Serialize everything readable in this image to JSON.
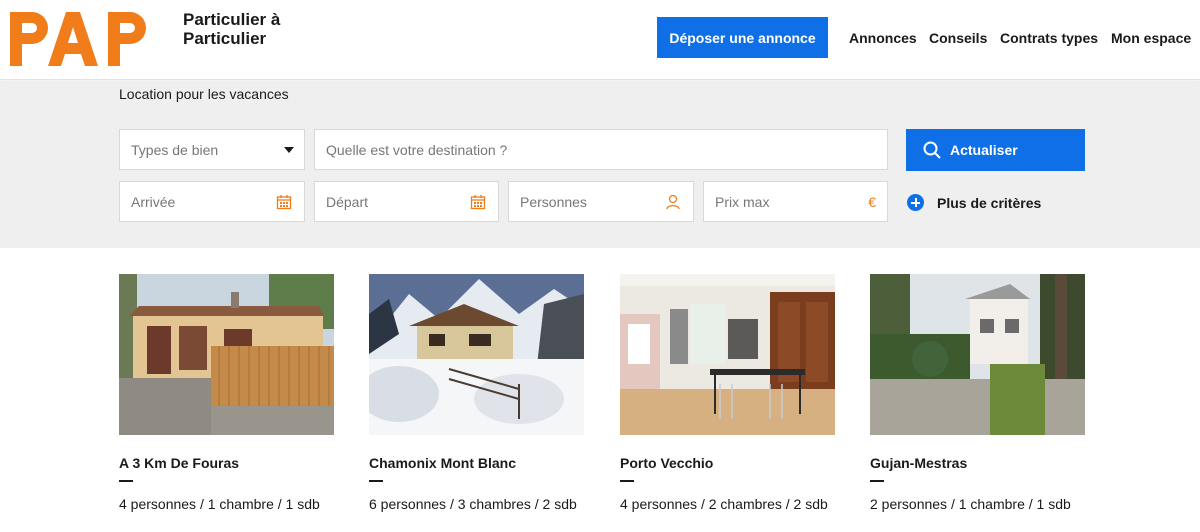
{
  "header": {
    "logo_text": "PAP",
    "tagline_line1": "Particulier à",
    "tagline_line2": "Particulier",
    "cta_label": "Déposer une annonce",
    "nav": [
      "Annonces",
      "Conseils",
      "Contrats types",
      "Mon espace"
    ],
    "brand_color": "#f07d1a",
    "accent_color": "#0f6fe6"
  },
  "search": {
    "title": "Location pour les vacances",
    "types_placeholder": "Types de bien",
    "destination_placeholder": "Quelle est votre destination ?",
    "arrival_placeholder": "Arrivée",
    "departure_placeholder": "Départ",
    "persons_placeholder": "Personnes",
    "price_placeholder": "Prix max",
    "currency_symbol": "€",
    "update_label": "Actualiser",
    "more_criteria_label": "Plus de critères"
  },
  "listings": [
    {
      "title": "A 3 Km De Fouras",
      "details": "4 personnes / 1 chambre / 1 sdb",
      "photo": "house-with-wooden-fence"
    },
    {
      "title": "Chamonix Mont Blanc",
      "details": "6 personnes / 3 chambres / 2 sdb",
      "photo": "chalet-in-snow"
    },
    {
      "title": "Porto Vecchio",
      "details": "4 personnes / 2 chambres / 2 sdb",
      "photo": "dining-room-interior"
    },
    {
      "title": "Gujan-Mestras",
      "details": "2 personnes / 1 chambre / 1 sdb",
      "photo": "white-villa-with-trees"
    }
  ]
}
